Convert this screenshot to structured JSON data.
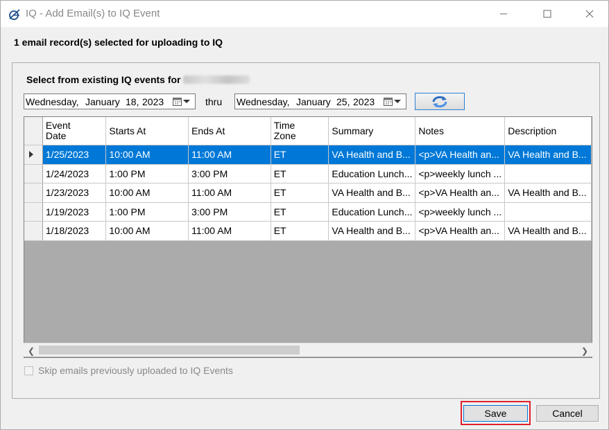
{
  "window": {
    "title": "IQ - Add Email(s) to IQ Event",
    "icon": "iq-logo-icon"
  },
  "header": {
    "text": "1 email record(s) selected for uploading to IQ"
  },
  "panel": {
    "section_label": "Select from existing IQ events for",
    "thru_label": "thru",
    "from_date": {
      "day": "Wednesday,",
      "month": "January",
      "date": "18,",
      "year": "2023"
    },
    "to_date": {
      "day": "Wednesday,",
      "month": "January",
      "date": "25,",
      "year": "2023"
    }
  },
  "grid": {
    "columns": [
      "Event Date",
      "Starts At",
      "Ends At",
      "Time Zone",
      "Summary",
      "Notes",
      "Description"
    ],
    "rows": [
      [
        "1/25/2023",
        "10:00 AM",
        "11:00 AM",
        "ET",
        "VA Health and B...",
        "<p>VA Health an...",
        "VA Health and B..."
      ],
      [
        "1/24/2023",
        "1:00 PM",
        "3:00 PM",
        "ET",
        "Education Lunch...",
        "<p>weekly lunch ...",
        ""
      ],
      [
        "1/23/2023",
        "10:00 AM",
        "11:00 AM",
        "ET",
        "VA Health and B...",
        "<p>VA Health an...",
        "VA Health and B..."
      ],
      [
        "1/19/2023",
        "1:00 PM",
        "3:00 PM",
        "ET",
        "Education Lunch...",
        "<p>weekly lunch ...",
        ""
      ],
      [
        "1/18/2023",
        "10:00 AM",
        "11:00 AM",
        "ET",
        "VA Health and B...",
        "<p>VA Health an...",
        "VA Health and B..."
      ]
    ],
    "selected_row": 0
  },
  "checkbox": {
    "label": "Skip emails previously uploaded to IQ Events",
    "checked": false
  },
  "buttons": {
    "save": "Save",
    "cancel": "Cancel"
  },
  "colors": {
    "selection": "#0078d7",
    "highlight": "#e0202a"
  }
}
